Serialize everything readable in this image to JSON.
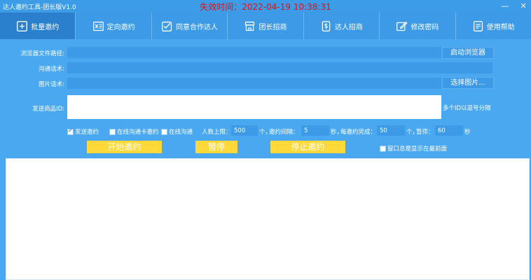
{
  "window": {
    "title": "达人邀约工具-团长版V1.0",
    "expiry": "失效时间：2022-04-19 10:38:31",
    "minimize_glyph": "—",
    "close_glyph": "✕"
  },
  "tabs": [
    {
      "label": "批量邀约",
      "icon": "plus-square-icon"
    },
    {
      "label": "定向邀约",
      "icon": "excel-icon"
    },
    {
      "label": "同意合作达人",
      "icon": "checkbox-icon"
    },
    {
      "label": "团长招商",
      "icon": "shop-icon"
    },
    {
      "label": "达人招商",
      "icon": "dollar-phone-icon"
    },
    {
      "label": "修改密码",
      "icon": "edit-icon"
    },
    {
      "label": "使用帮助",
      "icon": "help-doc-icon"
    }
  ],
  "form": {
    "browser_path_label": "浏览器文件路径:",
    "browser_path_value": "",
    "start_browser_button": "启动浏览器",
    "script_label": "沟通话术:",
    "script_value": "",
    "image_script_label": "图片话术:",
    "image_script_value": "",
    "select_image_button": "选择图片...",
    "product_id_label": "发送商品ID:",
    "product_id_value": "",
    "product_id_hint": "多个ID以逗号分隔"
  },
  "options": {
    "send_invite": {
      "label": "发送邀约",
      "checked": true
    },
    "online_card": {
      "label": "在线沟通卡邀约",
      "checked": false
    },
    "online_chat": {
      "label": "在线沟通",
      "checked": false
    },
    "max_people_label": "人数上限：",
    "max_people_value": "500",
    "max_people_unit": "个，",
    "interval_label": "邀约间隔：",
    "interval_value": "5",
    "interval_unit": "秒，",
    "batch_label": "每邀约完成：",
    "batch_value": "50",
    "batch_unit": "个，",
    "pause_label": "暂停：",
    "pause_value": "60",
    "pause_unit": "秒",
    "always_on_top": {
      "label": "窗口总是显示在最前面",
      "checked": false
    }
  },
  "actions": {
    "start": "开始邀约",
    "pause": "暂停",
    "stop": "停止邀约"
  },
  "colors": {
    "background": "#4aa8f0",
    "tab_active": "#2a80cc",
    "accent_yellow": "#ffd93a",
    "expiry_red": "#e01010"
  }
}
